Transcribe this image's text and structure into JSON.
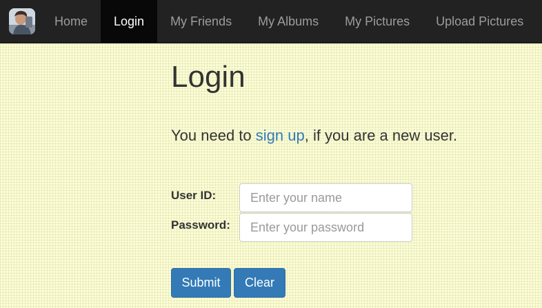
{
  "nav": {
    "items": [
      {
        "label": "Home"
      },
      {
        "label": "Login"
      },
      {
        "label": "My Friends"
      },
      {
        "label": "My Albums"
      },
      {
        "label": "My Pictures"
      },
      {
        "label": "Upload Pictures"
      }
    ],
    "active": "Login"
  },
  "page": {
    "title": "Login",
    "intro_prefix": "You need to ",
    "intro_link": "sign up",
    "intro_suffix": ", if you are a new user."
  },
  "form": {
    "userid_label": "User ID:",
    "userid_placeholder": "Enter your name",
    "userid_value": "",
    "password_label": "Password:",
    "password_placeholder": "Enter your password",
    "password_value": "",
    "submit_label": "Submit",
    "clear_label": "Clear"
  },
  "colors": {
    "navbar": "#222222",
    "active_tab": "#080808",
    "primary_button": "#337ab7",
    "link": "#337ab7",
    "page_background": "#fdfdd8"
  },
  "icons": {
    "brand": "user-avatar-icon"
  }
}
